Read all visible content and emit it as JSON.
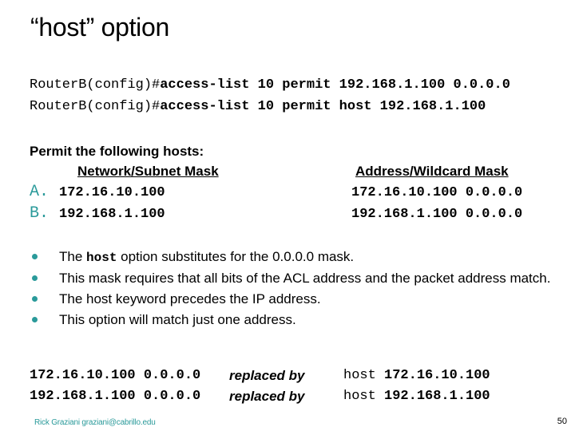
{
  "title": "“host” option",
  "commands": [
    {
      "prompt": "RouterB(config)#",
      "command": "access-list 10 permit 192.168.1.100 0.0.0.0"
    },
    {
      "prompt": "RouterB(config)#",
      "command": "access-list 10 permit host 192.168.1.100"
    }
  ],
  "permit_heading": "Permit the following hosts:",
  "columns": {
    "left": "Network/Subnet Mask",
    "right": "Address/Wildcard Mask"
  },
  "hosts": [
    {
      "label": "A.",
      "network": "172.16.10.100",
      "wildcard": "172.16.10.100 0.0.0.0"
    },
    {
      "label": "B.",
      "network": "192.168.1.100",
      "wildcard": "192.168.1.100 0.0.0.0"
    }
  ],
  "bullets": {
    "b1_pre": "The ",
    "b1_code": "host",
    "b1_post": " option substitutes for the 0.0.0.0 mask.",
    "b2": "This mask requires that all bits of the ACL address and the packet address match.",
    "b3": "The host keyword precedes the IP address.",
    "b4": "This option will match just one address."
  },
  "replacements": [
    {
      "original": "172.16.10.100 0.0.0.0",
      "verb": "replaced by",
      "keyword": "host",
      "address": "172.16.10.100"
    },
    {
      "original": "192.168.1.100 0.0.0.0",
      "verb": "replaced by",
      "keyword": "host",
      "address": "192.168.1.100"
    }
  ],
  "footer": {
    "author": "Rick Graziani  graziani@cabrillo.edu",
    "page_number": "50"
  },
  "colors": {
    "accent": "#2a9a9a",
    "text": "#000000",
    "background": "#ffffff"
  }
}
